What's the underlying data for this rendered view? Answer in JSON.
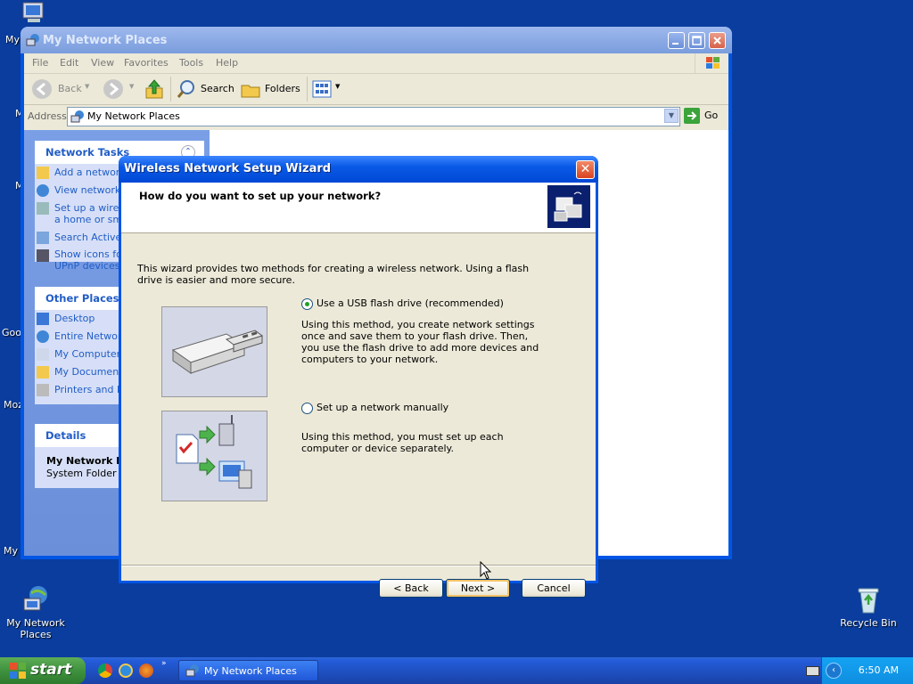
{
  "desktop": {
    "icons": [
      {
        "label": "My Network Places"
      },
      {
        "label": "Recycle Bin"
      }
    ],
    "edge_labels": [
      "My",
      "M",
      "M",
      "Goo",
      "Moz",
      "My I"
    ]
  },
  "explorer": {
    "title": "My Network Places",
    "menu": [
      "File",
      "Edit",
      "View",
      "Favorites",
      "Tools",
      "Help"
    ],
    "toolbar": {
      "back": "Back",
      "search": "Search",
      "folders": "Folders"
    },
    "address": {
      "label": "Address",
      "value": "My Network Places",
      "go": "Go"
    },
    "network_tasks": {
      "title": "Network Tasks",
      "items": [
        "Add a network place",
        "View network connections",
        "Set up a wireless network for a home or small office",
        "Search Active Directory",
        "Show icons for networked UPnP devices"
      ]
    },
    "other_places": {
      "title": "Other Places",
      "items": [
        "Desktop",
        "Entire Network",
        "My Computer",
        "My Documents",
        "Printers and Faxes"
      ]
    },
    "details": {
      "title": "Details",
      "name": "My Network Places",
      "type": "System Folder"
    }
  },
  "wizard": {
    "title": "Wireless Network Setup Wizard",
    "question": "How do you want to set up your network?",
    "intro": "This wizard provides two methods for creating a wireless network. Using a flash drive is easier and more secure.",
    "options": [
      {
        "label": "Use a USB flash drive (recommended)",
        "selected": true,
        "description": "Using this method, you create network settings once and save them to your flash drive. Then, you use the flash drive to add more devices and computers to your network."
      },
      {
        "label": "Set up a network manually",
        "selected": false,
        "description": "Using this method, you must set up each computer or device separately."
      }
    ],
    "buttons": {
      "back": "< Back",
      "next": "Next >",
      "cancel": "Cancel"
    }
  },
  "taskbar": {
    "start": "start",
    "task": "My Network Places",
    "clock": "6:50 AM"
  },
  "colors": {
    "desktop": "#0a3d9e",
    "titlebar": "#0a5ae6",
    "panel_link": "#215dc6"
  }
}
